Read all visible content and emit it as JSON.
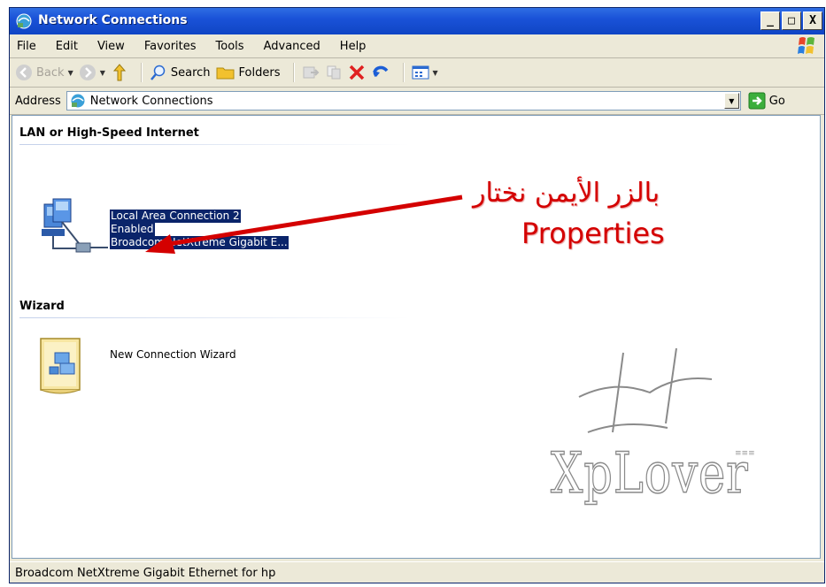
{
  "window": {
    "title": "Network Connections"
  },
  "menu": [
    "File",
    "Edit",
    "View",
    "Favorites",
    "Tools",
    "Advanced",
    "Help"
  ],
  "toolbar": {
    "back": "Back",
    "search": "Search",
    "folders": "Folders"
  },
  "address": {
    "label": "Address",
    "value": "Network Connections",
    "go": "Go"
  },
  "groups": {
    "lan_header": "LAN or High-Speed Internet",
    "wizard_header": "Wizard"
  },
  "lan_item": {
    "name": "Local Area Connection 2",
    "status": "Enabled",
    "device": "Broadcom NetXtreme Gigabit E..."
  },
  "wizard_item": {
    "name": "New Connection Wizard"
  },
  "annotation": {
    "arabic": "بالزر الأيمن نختار",
    "english": "Properties"
  },
  "watermark": {
    "text": "XpLover"
  },
  "status": {
    "text": "Broadcom NetXtreme Gigabit Ethernet for hp"
  },
  "colors": {
    "title_bar": "#1a52d8",
    "selection": "#0a246a",
    "annotation": "#d40000"
  }
}
